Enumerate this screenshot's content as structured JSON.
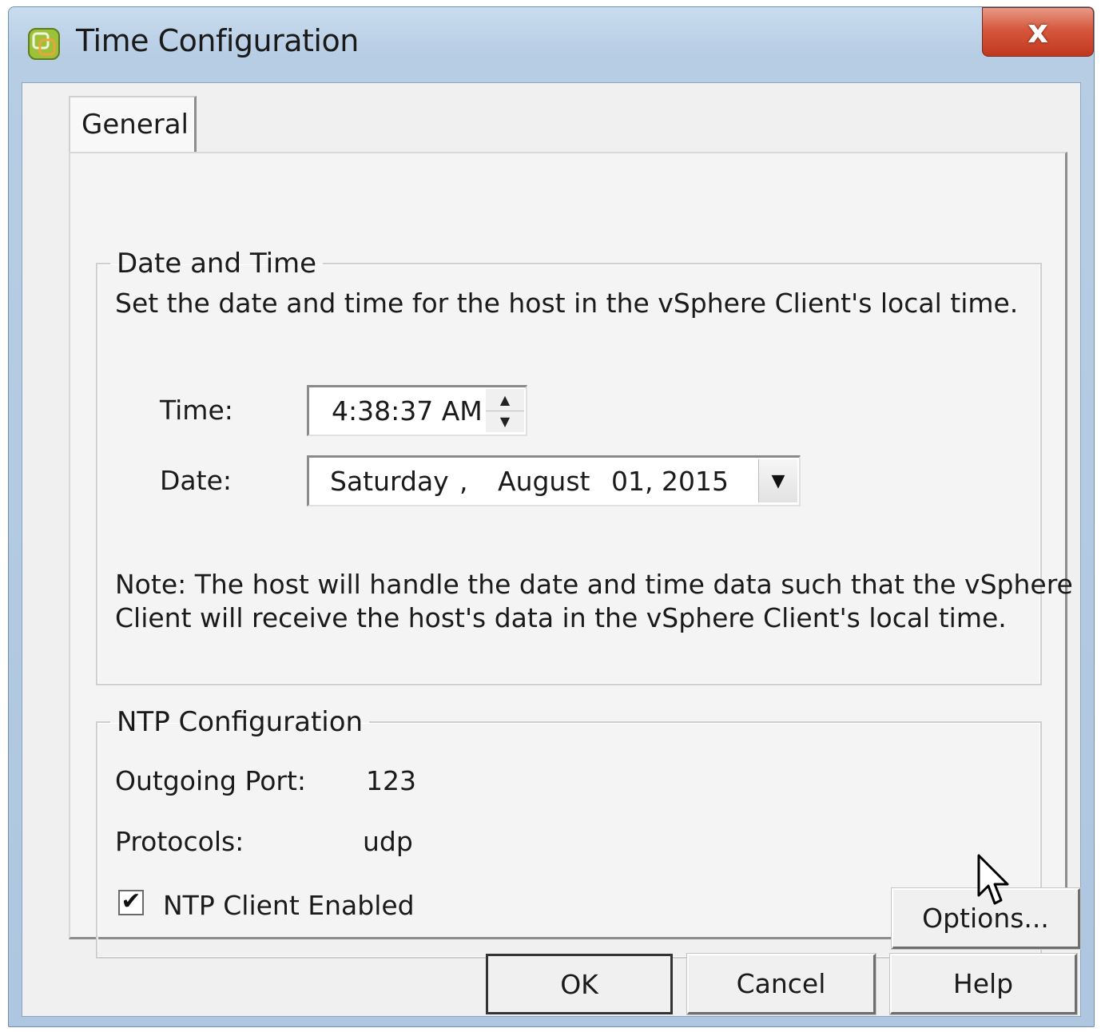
{
  "window": {
    "title": "Time Configuration",
    "close_label": "x"
  },
  "tabs": [
    {
      "label": "General"
    }
  ],
  "date_time": {
    "legend": "Date and Time",
    "description": "Set the date and time for the host in the vSphere Client's local time.",
    "time_label": "Time:",
    "time_value": "4:38:37 AM",
    "date_label": "Date:",
    "date_weekday": "Saturday",
    "date_sep": ",",
    "date_month": "August",
    "date_day_year": "01, 2015",
    "note_line1": "Note: The host will handle the date and time data such that the vSphere",
    "note_line2": "Client will receive the host's data in the vSphere Client's local time."
  },
  "ntp": {
    "legend": "NTP Configuration",
    "outgoing_port_label": "Outgoing Port:",
    "outgoing_port_value": "123",
    "protocols_label": "Protocols:",
    "protocols_value": "udp",
    "client_enabled_label": "NTP Client Enabled",
    "client_enabled_checked": true,
    "options_label": "Options..."
  },
  "footer": {
    "ok_label": "OK",
    "cancel_label": "Cancel",
    "help_label": "Help"
  },
  "icons": {
    "app": "vsphere-app-icon",
    "close": "close-icon",
    "spin_up": "spin-up-icon",
    "spin_down": "spin-down-icon",
    "dropdown": "chevron-down-icon",
    "check": "checkmark-icon",
    "cursor": "mouse-pointer-icon"
  },
  "colors": {
    "titlebar": "#b7cde4",
    "close": "#c0381f",
    "dialog_bg": "#f0f0f0"
  }
}
